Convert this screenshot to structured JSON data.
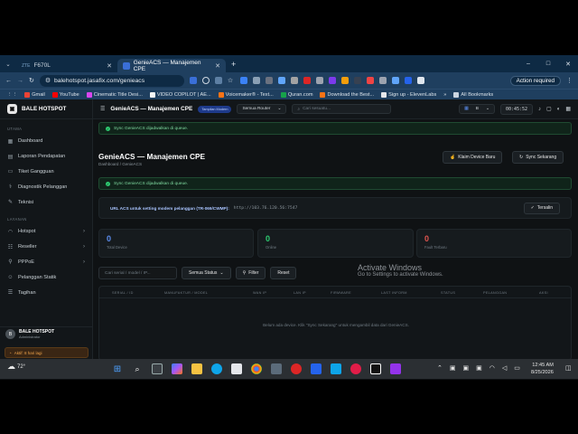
{
  "browser": {
    "tabs": [
      {
        "label": "F670L",
        "active": false
      },
      {
        "label": "GenieACS — Manajemen CPE",
        "active": true
      }
    ],
    "new_tab": "+",
    "window_controls": [
      "–",
      "□",
      "✕"
    ],
    "url": "balehotspot.jasafix.com/genieacs",
    "action_required": "Action required",
    "bookmarks": [
      "Gmail",
      "YouTube",
      "Cinematic Title Desi...",
      "VIDEO COPILOT | AE...",
      "Voicemaker® - Text...",
      "Quran.com",
      "Download the Best...",
      "Sign up - ElevenLabs"
    ],
    "all_bookmarks": "All Bookmarks"
  },
  "sidebar": {
    "brand": "BALE HOTSPOT",
    "sections": [
      {
        "title": "UTAMA",
        "items": [
          {
            "label": "Dashboard",
            "icon": "grid-icon"
          },
          {
            "label": "Laporan Pendapatan",
            "icon": "chart-icon"
          },
          {
            "label": "Tiket Gangguan",
            "icon": "ticket-icon"
          },
          {
            "label": "Diagnostik Pelanggan",
            "icon": "stethoscope-icon"
          },
          {
            "label": "Teknisi",
            "icon": "wrench-icon"
          }
        ]
      },
      {
        "title": "LAYANAN",
        "items": [
          {
            "label": "Hotspot",
            "icon": "wifi-icon",
            "chevron": true
          },
          {
            "label": "Reseller",
            "icon": "users-icon",
            "chevron": true
          },
          {
            "label": "PPPoE",
            "icon": "plug-icon",
            "chevron": true
          },
          {
            "label": "Pelanggan Statik",
            "icon": "user-icon"
          },
          {
            "label": "Tagihan",
            "icon": "receipt-icon"
          }
        ]
      }
    ],
    "user": {
      "name": "BALE HOTSPOT",
      "role": "Administrator",
      "initials": "B"
    },
    "trial": "Aktif: 8 hari lagi"
  },
  "topbar": {
    "title": "GenieACS — Manajemen CPE",
    "badge": "Tampilan Modern",
    "router_select": "Semua Router",
    "search_placeholder": "Cari sesuatu...",
    "mode": "B",
    "clock": "00:45:52"
  },
  "main": {
    "alert_top": "Sync GenieACS dijadwalkan di queue.",
    "page_title": "GenieACS — Manajemen CPE",
    "breadcrumb": "Dashboard / GenieACS",
    "claim_button": "Klaim Device Baru",
    "sync_button": "Sync Sekarang",
    "alert_second": "Sync GenieACS dijadwalkan di queue.",
    "acs_label": "URL ACS untuk setting modem pelanggan (TR-069/CWMP):",
    "acs_value": "http://103.76.120.56:7547",
    "acs_status": "Tersalin",
    "stats": [
      {
        "value": "0",
        "label": "Total Device",
        "color": "#5b8def"
      },
      {
        "value": "0",
        "label": "Online",
        "color": "#2ecc71"
      },
      {
        "value": "0",
        "label": "Fault Terbaru",
        "color": "#e0554f"
      }
    ],
    "filter": {
      "search_placeholder": "Cari serial / model / IP...",
      "status_select": "Semua Status",
      "filter_button": "Filter",
      "reset_button": "Reset"
    },
    "table": {
      "columns": [
        "SERIAL / ID",
        "MANUFAKTUR / MODEL",
        "WAN IP",
        "LAN IP",
        "FIRMWARE",
        "LAST INFORM",
        "STATUS",
        "PELANGGAN",
        "AKSI"
      ],
      "empty": "Belum ada device. Klik \"Sync Sekarang\" untuk mengambil data dari GenieACS."
    },
    "watermark_title": "Activate Windows",
    "watermark_sub": "Go to Settings to activate Windows."
  },
  "taskbar": {
    "weather": "72°",
    "time": "12:45 AM",
    "date": "8/25/2026"
  }
}
